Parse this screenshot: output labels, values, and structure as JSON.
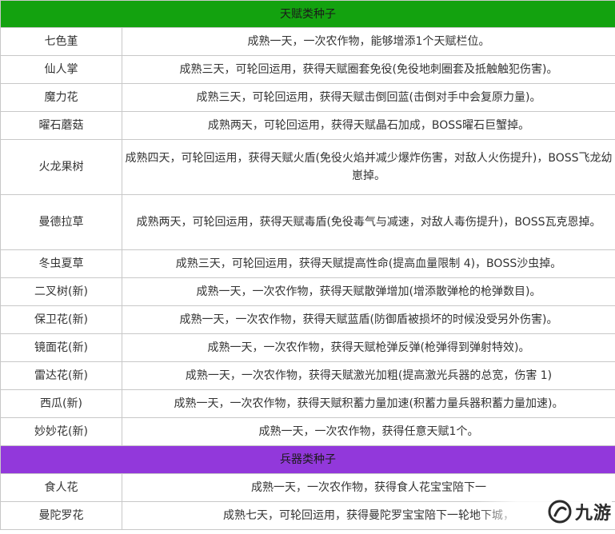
{
  "sections": [
    {
      "title": "天赋类种子",
      "color": "#13a20f",
      "rows": [
        {
          "name": "七色堇",
          "desc": "成熟一天，一次农作物，能够增添1个天赋栏位。"
        },
        {
          "name": "仙人掌",
          "desc": "成熟三天，可轮回运用，获得天赋圈套免役(免役地刺圈套及抵触触犯伤害)。"
        },
        {
          "name": "魔力花",
          "desc": "成熟三天，可轮回运用，获得天赋击倒回蓝(击倒对手中会复原力量)。"
        },
        {
          "name": "曜石蘑菇",
          "desc": "成熟两天，可轮回运用，获得天赋晶石加成，BOSS曜石巨蟹掉。"
        },
        {
          "name": "火龙果树",
          "desc": "成熟四天，可轮回运用，获得天赋火盾(免役火焰并减少爆炸伤害，对敌人火伤提升)，BOSS飞龙幼崽掉。"
        },
        {
          "name": "曼德拉草",
          "desc": "成熟两天，可轮回运用，获得天赋毒盾(免役毒气与减速，对敌人毒伤提升)，BOSS瓦克恩掉。"
        },
        {
          "name": "冬虫夏草",
          "desc": "成熟三天，可轮回运用，获得天赋提高性命(提高血量限制 4)，BOSS沙虫掉。"
        },
        {
          "name": "二叉树(新)",
          "desc": "成熟一天，一次农作物，获得天赋散弹增加(增添散弹枪的枪弹数目)。"
        },
        {
          "name": "保卫花(新)",
          "desc": "成熟一天，一次农作物，获得天赋蓝盾(防御盾被损坏的时候没受另外伤害)。"
        },
        {
          "name": "镜面花(新)",
          "desc": "成熟一天，一次农作物，获得天赋枪弹反弹(枪弹得到弹射特效)。"
        },
        {
          "name": "雷达花(新)",
          "desc": "成熟一天，一次农作物，获得天赋激光加粗(提高激光兵器的总宽，伤害 1)"
        },
        {
          "name": "西瓜(新)",
          "desc": "成熟一天，一次农作物，获得天赋积蓄力量加速(积蓄力量兵器积蓄力量加速)。"
        },
        {
          "name": "妙妙花(新)",
          "desc": "成熟一天，一次农作物，获得任意天赋1个。"
        }
      ]
    },
    {
      "title": "兵器类种子",
      "color": "#9238db",
      "rows": [
        {
          "name": "食人花",
          "desc": "成熟一天，一次农作物，获得食人花宝宝陪下一"
        },
        {
          "name": "曼陀罗花",
          "desc": "成熟七天，可轮回运用，获得曼陀罗宝宝陪下一轮地下城，"
        }
      ]
    }
  ],
  "watermark": {
    "text": "九游",
    "icon": "jiuyou-logo-icon"
  }
}
